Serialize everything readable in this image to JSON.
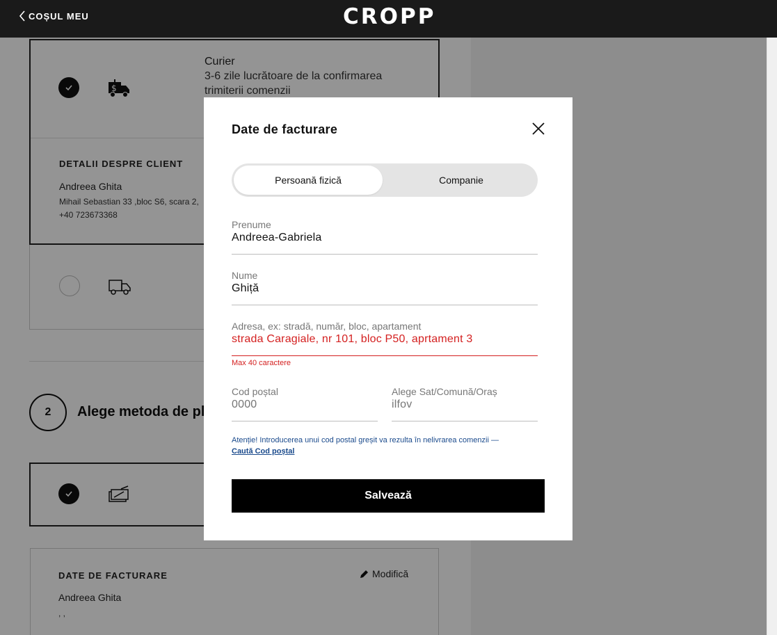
{
  "header": {
    "back_label": "COȘUL MEU",
    "logo": "CROPP"
  },
  "shipping": {
    "courier_title": "Curier",
    "courier_desc_1": "3-6 zile lucrătoare de la confirmarea",
    "courier_desc_2": "trimiterii comenzii",
    "client_section": "DETALII DESPRE CLIENT",
    "client_name": "Andreea Ghita",
    "client_address": "Mihail Sebastian 33 ,bloc S6, scara 2,",
    "client_phone": "+40 723673368"
  },
  "payment": {
    "step_number": "2",
    "step_title": "Alege metoda de pl"
  },
  "billing_summary": {
    "section": "DATE DE FACTURARE",
    "edit_label": "Modifică",
    "name": "Andreea Ghita",
    "address": ", ,"
  },
  "modal": {
    "title": "Date de facturare",
    "tabs": [
      {
        "label": "Persoană fizică",
        "active": true
      },
      {
        "label": "Companie",
        "active": false
      }
    ],
    "fields": {
      "first_name": {
        "label": "Prenume",
        "value": "Andreea-Gabriela"
      },
      "last_name": {
        "label": "Nume",
        "value": "Ghiță"
      },
      "address": {
        "label": "Adresa, ex: stradă, număr, bloc, apartament",
        "value": "strada Caragiale, nr 101, bloc P50, aprtament 3",
        "error": "Max 40 caractere"
      },
      "postal_code": {
        "label": "Cod poștal",
        "placeholder": "0000"
      },
      "locality": {
        "label": "Alege Sat/Comună/Oraș",
        "value": "ilfov"
      }
    },
    "note": "Atenție! Introducerea unui cod postal greșit va rezulta în nelivrarea comenzii —",
    "note_link": "Caută Cod poștal",
    "save_label": "Salvează"
  },
  "colors": {
    "header_bg": "#1a1a1a",
    "error": "#d42020",
    "link": "#1a4a8c",
    "button_bg": "#000000"
  }
}
